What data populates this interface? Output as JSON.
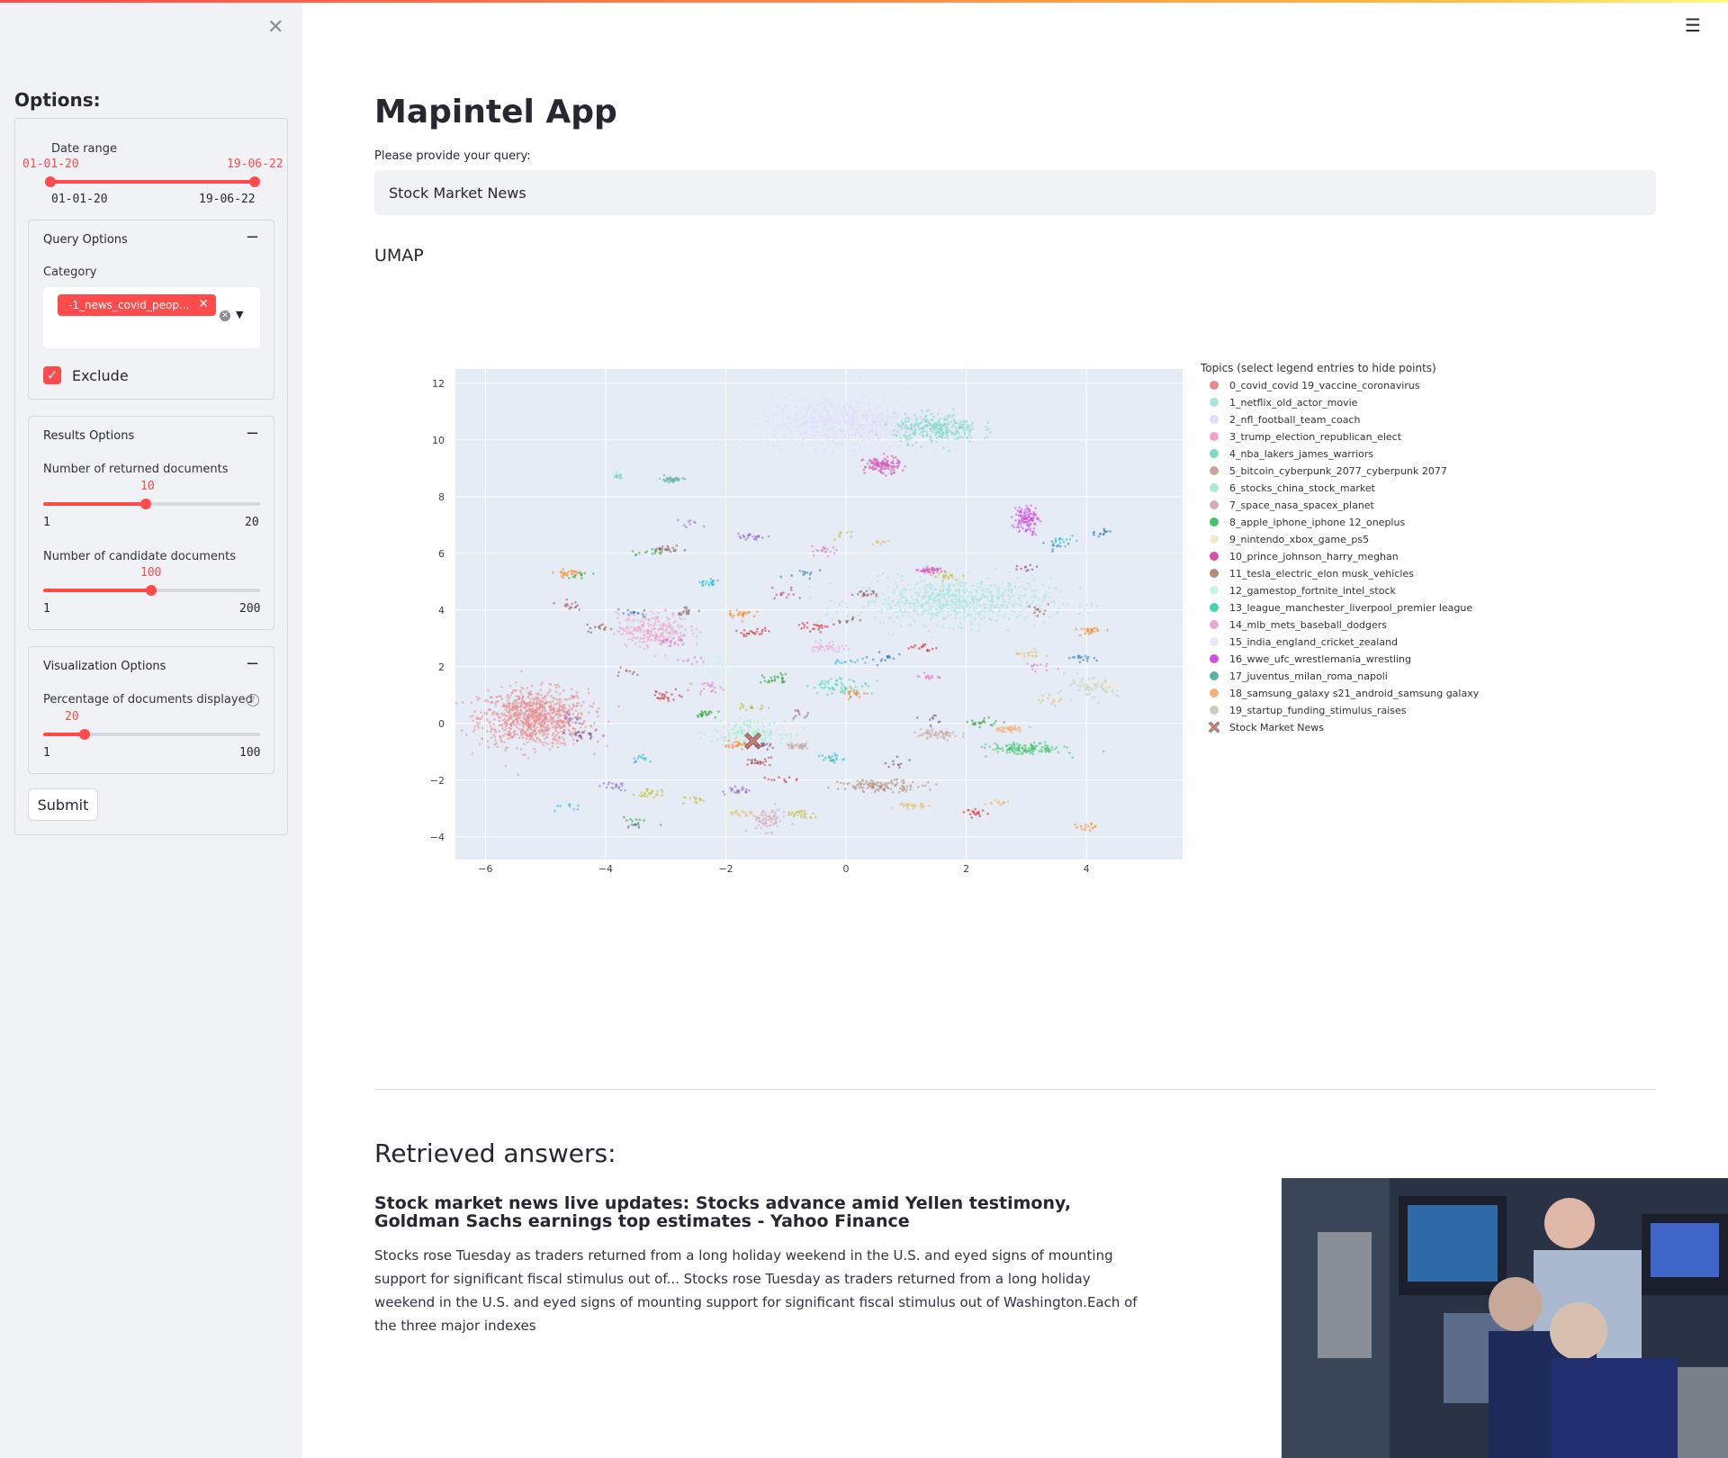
{
  "sidebar": {
    "title": "Options:",
    "date_range": {
      "label": "Date range",
      "start": "01-01-20",
      "end": "19-06-22",
      "min": "01-01-20",
      "max": "19-06-22"
    },
    "query_options": {
      "header": "Query Options",
      "category_label": "Category",
      "selected_chip": "-1_news_covid_peop...",
      "exclude_label": "Exclude",
      "exclude_checked": true
    },
    "results_options": {
      "header": "Results Options",
      "returned": {
        "label": "Number of returned documents",
        "value": "10",
        "min": "1",
        "max": "20",
        "fraction": 0.474
      },
      "candidate": {
        "label": "Number of candidate documents",
        "value": "100",
        "min": "1",
        "max": "200",
        "fraction": 0.497
      }
    },
    "visualization_options": {
      "header": "Visualization Options",
      "percentage": {
        "label": "Percentage of documents displayed",
        "value": "20",
        "min": "1",
        "max": "100",
        "fraction": 0.192
      }
    },
    "submit_label": "Submit"
  },
  "main": {
    "title": "Mapintel App",
    "query_label": "Please provide your query:",
    "query_value": "Stock Market News",
    "umap_title": "UMAP",
    "retrieved_title": "Retrieved answers:",
    "answer": {
      "title": "Stock market news live updates: Stocks advance amid Yellen testimony, Goldman Sachs earnings top estimates - Yahoo Finance",
      "text": "Stocks rose Tuesday as traders returned from a long holiday weekend in the U.S. and eyed signs of mounting support for significant fiscal stimulus out of... Stocks rose Tuesday as traders returned from a long holiday weekend in the U.S. and eyed signs of mounting support for significant fiscal stimulus out of Washington.Each of the three major indexes"
    }
  },
  "chart_data": {
    "type": "scatter",
    "xlim": [
      -6.5,
      5.6
    ],
    "ylim": [
      -4.8,
      12.5
    ],
    "x_ticks": [
      -6,
      -4,
      -2,
      0,
      2,
      4
    ],
    "y_ticks": [
      -4,
      -2,
      0,
      2,
      4,
      6,
      8,
      10,
      12
    ],
    "grid": true,
    "legend_position": "right",
    "legend_title": "Topics (select legend entries to hide points)",
    "series": [
      {
        "name": "0_covid_covid 19_vaccine_coronavirus",
        "color": "#e88a8a",
        "clusters": [
          [
            -5.2,
            0.2,
            0.9,
            1.0,
            900
          ]
        ]
      },
      {
        "name": "1_netflix_old_actor_movie",
        "color": "#a8e6da",
        "clusters": [
          [
            1.8,
            4.3,
            1.6,
            0.8,
            700
          ]
        ]
      },
      {
        "name": "2_nfl_football_team_coach",
        "color": "#e2dcfb",
        "clusters": [
          [
            0.0,
            10.6,
            1.3,
            0.9,
            700
          ]
        ]
      },
      {
        "name": "3_trump_election_republican_elect",
        "color": "#f0a2c8",
        "clusters": [
          [
            -3.2,
            3.3,
            0.6,
            0.6,
            250
          ]
        ]
      },
      {
        "name": "4_nba_lakers_james_warriors",
        "color": "#7fd9c4",
        "clusters": [
          [
            1.5,
            10.4,
            0.7,
            0.5,
            300
          ],
          [
            -3.8,
            8.7,
            0.1,
            0.1,
            20
          ]
        ]
      },
      {
        "name": "5_bitcoin_cyberpunk_2077_cyberpunk 2077",
        "color": "#c9a89a",
        "clusters": [
          [
            1.5,
            -0.4,
            0.4,
            0.2,
            60
          ],
          [
            -0.8,
            -0.8,
            0.2,
            0.1,
            40
          ]
        ]
      },
      {
        "name": "6_stocks_china_stock_market",
        "color": "#a6efc4",
        "clusters": [
          [
            -1.6,
            -0.3,
            0.6,
            0.4,
            150
          ]
        ]
      },
      {
        "name": "7_space_nasa_spacex_planet",
        "color": "#d8aab8",
        "clusters": [
          [
            -1.3,
            -3.4,
            0.3,
            0.4,
            80
          ]
        ]
      },
      {
        "name": "8_apple_iphone_iphone 12_oneplus",
        "color": "#42c46b",
        "clusters": [
          [
            3.0,
            -0.9,
            0.6,
            0.2,
            140
          ]
        ]
      },
      {
        "name": "9_nintendo_xbox_game_ps5",
        "color": "#f0ead0",
        "clusters": [
          [
            4.3,
            1.3,
            0.3,
            0.3,
            60
          ]
        ]
      },
      {
        "name": "10_prince_johnson_harry_meghan",
        "color": "#d94fb0",
        "clusters": [
          [
            0.6,
            9.1,
            0.3,
            0.3,
            120
          ],
          [
            1.4,
            5.4,
            0.2,
            0.1,
            40
          ]
        ]
      },
      {
        "name": "11_tesla_electric_elon musk_vehicles",
        "color": "#b48c7a",
        "clusters": [
          [
            0.6,
            -2.2,
            0.7,
            0.2,
            120
          ]
        ]
      },
      {
        "name": "12_gamestop_fortnite_intel_stock",
        "color": "#ccf3ec",
        "clusters": [
          [
            -2.2,
            2.0,
            0.5,
            0.5,
            80
          ]
        ]
      },
      {
        "name": "13_league_manchester_liverpool_premier league",
        "color": "#44d6b0",
        "clusters": [
          [
            -0.1,
            1.3,
            0.5,
            0.3,
            60
          ]
        ]
      },
      {
        "name": "14_mlb_mets_baseball_dodgers",
        "color": "#e8a8d8",
        "clusters": [
          [
            -0.3,
            2.7,
            0.3,
            0.2,
            40
          ]
        ]
      },
      {
        "name": "15_india_england_cricket_zealand",
        "color": "#ebe8fb",
        "clusters": [
          [
            -4.1,
            -0.4,
            0.2,
            0.2,
            30
          ]
        ]
      },
      {
        "name": "16_wwe_ufc_wrestlemania_wrestling",
        "color": "#cf4fe0",
        "clusters": [
          [
            3.0,
            7.2,
            0.2,
            0.5,
            120
          ]
        ]
      },
      {
        "name": "17_juventus_milan_roma_napoli",
        "color": "#5fb0a8",
        "clusters": [
          [
            -2.9,
            8.6,
            0.2,
            0.1,
            40
          ]
        ]
      },
      {
        "name": "18_samsung_galaxy s21_android_samsung galaxy",
        "color": "#f6b07a",
        "clusters": [
          [
            2.7,
            -0.2,
            0.3,
            0.1,
            50
          ]
        ]
      },
      {
        "name": "19_startup_funding_stimulus_raises",
        "color": "#c8cfb8",
        "clusters": [
          [
            4.0,
            1.2,
            0.5,
            0.4,
            60
          ]
        ]
      },
      {
        "name": "Stock Market News",
        "color": "#c0504d",
        "marker": "x",
        "points": [
          [
            -1.55,
            -0.62
          ]
        ]
      }
    ],
    "extra_colors": [
      "#d62728",
      "#e377c2",
      "#2ca02c",
      "#ff7f0e",
      "#8c564b",
      "#17becf",
      "#9467bd",
      "#bcbd22",
      "#1f77b4",
      "#e7ba52",
      "#ad494a",
      "#7b4173"
    ]
  },
  "colors": {
    "accent": "#ff4b4b",
    "sidebar_bg": "#f0f2f6",
    "plot_bg": "#e5ecf6"
  },
  "image": {
    "description_icon": "photo"
  }
}
